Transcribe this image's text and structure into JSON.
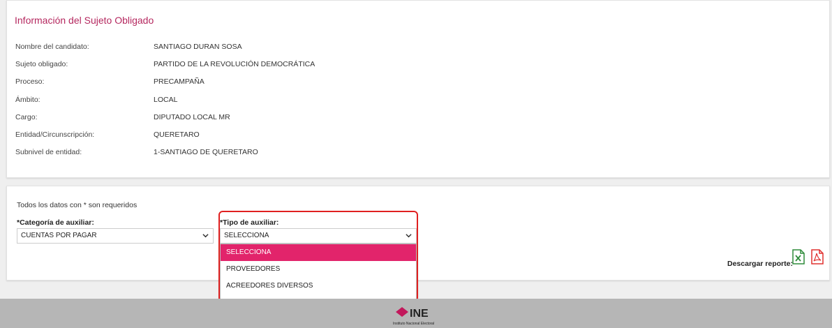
{
  "info": {
    "title": "Información del Sujeto Obligado",
    "rows": [
      {
        "label": "Nombre del candidato:",
        "value": "SANTIAGO DURAN SOSA"
      },
      {
        "label": "Sujeto obligado:",
        "value": "PARTIDO DE LA REVOLUCIÓN DEMOCRÁTICA"
      },
      {
        "label": "Proceso:",
        "value": "PRECAMPAÑA"
      },
      {
        "label": "Ámbito:",
        "value": "LOCAL"
      },
      {
        "label": "Cargo:",
        "value": "DIPUTADO LOCAL MR"
      },
      {
        "label": "Entidad/Circunscripción:",
        "value": "QUERETARO"
      },
      {
        "label": "Subnivel de entidad:",
        "value": "1-SANTIAGO DE QUERETARO"
      }
    ]
  },
  "form": {
    "required_note": "Todos los datos con * son requeridos",
    "categoria_label": "*Categoría de auxiliar:",
    "categoria_value": "CUENTAS POR PAGAR",
    "tipo_label": "*Tipo de auxiliar:",
    "tipo_value": "SELECCIONA",
    "tipo_options": [
      "SELECCIONA",
      "PROVEEDORES",
      "ACREEDORES DIVERSOS"
    ],
    "download_label": "Descargar reporte:"
  },
  "icons": {
    "chevron": "chevron-down-icon",
    "excel": "excel-file-icon",
    "pdf": "pdf-file-icon",
    "logo": "ine-logo"
  },
  "footer": {
    "logo_text": "INE",
    "logo_subtext": "Instituto Nacional Electoral"
  },
  "colors": {
    "accent": "#e2246b",
    "title": "#b5285f",
    "highlight": "#e02020",
    "excel": "#2e8b3a",
    "pdf": "#e0302e"
  }
}
